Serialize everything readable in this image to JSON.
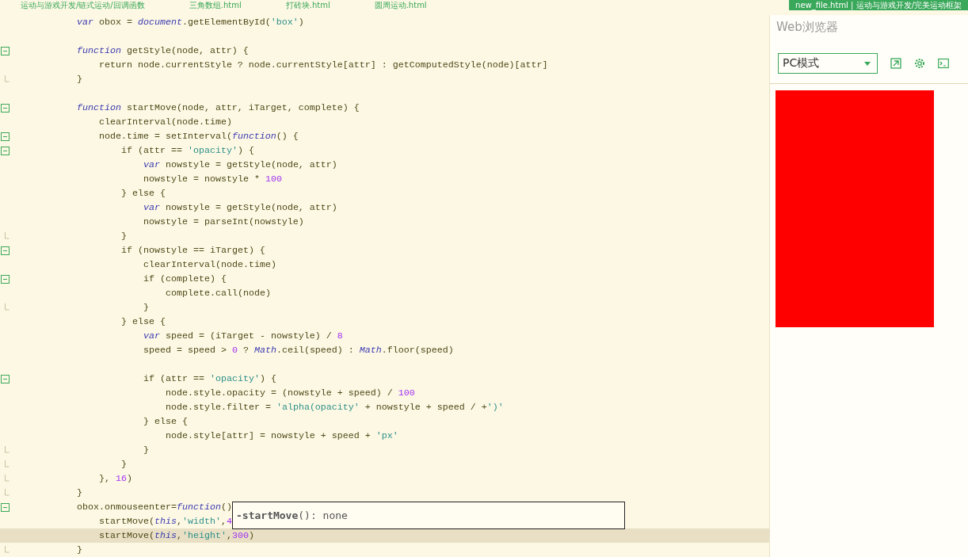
{
  "tabs": [
    {
      "label": "运动与游戏开发/链式运动/回调函数",
      "selected": false
    },
    {
      "label": "三角数组.html",
      "selected": false
    },
    {
      "label": "打砖块.html",
      "selected": false
    },
    {
      "label": "圆周运动.html",
      "selected": false
    },
    {
      "label": "new_file.html | 运动与游戏开发/完美运动框架",
      "selected": true
    }
  ],
  "editor": {
    "lines": [
      {
        "kind": "code",
        "active": false,
        "foldable": false,
        "tokens": [
          {
            "kind": "keyword",
            "text": "var"
          },
          {
            "kind": "plain",
            "text": " obox = "
          },
          {
            "kind": "keyword",
            "text": "document"
          },
          {
            "kind": "plain",
            "text": ".getElementById("
          },
          {
            "kind": "string",
            "text": "'box'"
          },
          {
            "kind": "plain",
            "text": ")"
          }
        ]
      },
      {
        "kind": "blank"
      },
      {
        "kind": "code",
        "active": false,
        "foldable": true,
        "tokens": [
          {
            "kind": "keyword",
            "text": "function"
          },
          {
            "kind": "plain",
            "text": " getStyle(node, attr) {"
          }
        ],
        "children": [
          {
            "kind": "code",
            "active": false,
            "foldable": false,
            "tokens": [
              {
                "kind": "plain",
                "text": "return node.currentStyle ? node.currentStyle[attr] : getComputedStyle(node)[attr]"
              }
            ]
          }
        ],
        "close": [
          {
            "kind": "plain",
            "text": "}"
          }
        ]
      },
      {
        "kind": "blank"
      },
      {
        "kind": "code",
        "active": false,
        "foldable": true,
        "tokens": [
          {
            "kind": "keyword",
            "text": "function"
          },
          {
            "kind": "plain",
            "text": " startMove(node, attr, iTarget, complete) {"
          }
        ],
        "children": [
          {
            "kind": "code",
            "active": false,
            "foldable": false,
            "tokens": [
              {
                "kind": "plain",
                "text": "clearInterval(node.time)"
              }
            ]
          },
          {
            "kind": "code",
            "active": false,
            "foldable": true,
            "tokens": [
              {
                "kind": "plain",
                "text": "node.time = setInterval("
              },
              {
                "kind": "keyword",
                "text": "function"
              },
              {
                "kind": "plain",
                "text": "() {"
              }
            ],
            "children": [
              {
                "kind": "code",
                "active": false,
                "foldable": true,
                "tokens": [
                  {
                    "kind": "plain",
                    "text": "if (attr == "
                  },
                  {
                    "kind": "string",
                    "text": "'opacity'"
                  },
                  {
                    "kind": "plain",
                    "text": ") {"
                  }
                ],
                "children": [
                  {
                    "kind": "code",
                    "active": false,
                    "foldable": false,
                    "tokens": [
                      {
                        "kind": "keyword",
                        "text": "var"
                      },
                      {
                        "kind": "plain",
                        "text": " nowstyle = getStyle(node, attr)"
                      }
                    ]
                  },
                  {
                    "kind": "code",
                    "active": false,
                    "foldable": false,
                    "tokens": [
                      {
                        "kind": "plain",
                        "text": "nowstyle = nowstyle * "
                      },
                      {
                        "kind": "number",
                        "text": "100"
                      }
                    ]
                  }
                ]
              },
              {
                "kind": "code",
                "active": false,
                "foldable": false,
                "tokens": [
                  {
                    "kind": "plain",
                    "text": "} else {"
                  }
                ],
                "children": [
                  {
                    "kind": "code",
                    "active": false,
                    "foldable": false,
                    "tokens": [
                      {
                        "kind": "keyword",
                        "text": "var"
                      },
                      {
                        "kind": "plain",
                        "text": " nowstyle = getStyle(node, attr)"
                      }
                    ]
                  },
                  {
                    "kind": "code",
                    "active": false,
                    "foldable": false,
                    "tokens": [
                      {
                        "kind": "plain",
                        "text": "nowstyle = parseInt(nowstyle)"
                      }
                    ]
                  }
                ],
                "close": [
                  {
                    "kind": "plain",
                    "text": "}"
                  }
                ]
              },
              {
                "kind": "code",
                "active": false,
                "foldable": true,
                "tokens": [
                  {
                    "kind": "plain",
                    "text": "if (nowstyle == iTarget) {"
                  }
                ],
                "children": [
                  {
                    "kind": "code",
                    "active": false,
                    "foldable": false,
                    "tokens": [
                      {
                        "kind": "plain",
                        "text": "clearInterval(node.time)"
                      }
                    ]
                  },
                  {
                    "kind": "code",
                    "active": false,
                    "foldable": true,
                    "tokens": [
                      {
                        "kind": "plain",
                        "text": "if (complete) {"
                      }
                    ],
                    "children": [
                      {
                        "kind": "code",
                        "active": false,
                        "foldable": false,
                        "tokens": [
                          {
                            "kind": "plain",
                            "text": "complete.call(node)"
                          }
                        ]
                      }
                    ],
                    "close": [
                      {
                        "kind": "plain",
                        "text": "}"
                      }
                    ]
                  }
                ]
              },
              {
                "kind": "code",
                "active": false,
                "foldable": false,
                "tokens": [
                  {
                    "kind": "plain",
                    "text": "} else {"
                  }
                ],
                "children": [
                  {
                    "kind": "code",
                    "active": false,
                    "foldable": false,
                    "tokens": [
                      {
                        "kind": "keyword",
                        "text": "var"
                      },
                      {
                        "kind": "plain",
                        "text": " speed = (iTarget - nowstyle) / "
                      },
                      {
                        "kind": "number",
                        "text": "8"
                      }
                    ]
                  },
                  {
                    "kind": "code",
                    "active": false,
                    "foldable": false,
                    "tokens": [
                      {
                        "kind": "plain",
                        "text": "speed = speed > "
                      },
                      {
                        "kind": "number",
                        "text": "0"
                      },
                      {
                        "kind": "plain",
                        "text": " ? "
                      },
                      {
                        "kind": "keyword",
                        "text": "Math"
                      },
                      {
                        "kind": "plain",
                        "text": ".ceil(speed) : "
                      },
                      {
                        "kind": "keyword",
                        "text": "Math"
                      },
                      {
                        "kind": "plain",
                        "text": ".floor(speed)"
                      }
                    ]
                  },
                  {
                    "kind": "blank"
                  },
                  {
                    "kind": "code",
                    "active": false,
                    "foldable": true,
                    "tokens": [
                      {
                        "kind": "plain",
                        "text": "if (attr == "
                      },
                      {
                        "kind": "string",
                        "text": "'opacity'"
                      },
                      {
                        "kind": "plain",
                        "text": ") {"
                      }
                    ],
                    "children": [
                      {
                        "kind": "code",
                        "active": false,
                        "foldable": false,
                        "tokens": [
                          {
                            "kind": "plain",
                            "text": "node.style.opacity = (nowstyle + speed) / "
                          },
                          {
                            "kind": "number",
                            "text": "100"
                          }
                        ]
                      },
                      {
                        "kind": "code",
                        "active": false,
                        "foldable": false,
                        "tokens": [
                          {
                            "kind": "plain",
                            "text": "node.style.filter = "
                          },
                          {
                            "kind": "string",
                            "text": "'alpha(opacity'"
                          },
                          {
                            "kind": "plain",
                            "text": " + nowstyle + speed / +"
                          },
                          {
                            "kind": "string",
                            "text": "')'"
                          }
                        ]
                      }
                    ]
                  },
                  {
                    "kind": "code",
                    "active": false,
                    "foldable": false,
                    "tokens": [
                      {
                        "kind": "plain",
                        "text": "} else {"
                      }
                    ],
                    "children": [
                      {
                        "kind": "code",
                        "active": false,
                        "foldable": false,
                        "tokens": [
                          {
                            "kind": "plain",
                            "text": "node.style[attr] = nowstyle + speed + "
                          },
                          {
                            "kind": "string",
                            "text": "'px'"
                          }
                        ]
                      }
                    ],
                    "close": [
                      {
                        "kind": "plain",
                        "text": "}"
                      }
                    ]
                  }
                ],
                "close": [
                  {
                    "kind": "plain",
                    "text": "}"
                  }
                ]
              }
            ],
            "close": [
              {
                "kind": "plain",
                "text": "}, "
              },
              {
                "kind": "number",
                "text": "16"
              },
              {
                "kind": "plain",
                "text": ")"
              }
            ]
          }
        ],
        "close": [
          {
            "kind": "plain",
            "text": "}"
          }
        ]
      },
      {
        "kind": "code",
        "active": false,
        "foldable": true,
        "tokens": [
          {
            "kind": "plain",
            "text": "obox.onmouseenter="
          },
          {
            "kind": "keyword",
            "text": "function"
          },
          {
            "kind": "plain",
            "text": "()"
          }
        ],
        "children": [
          {
            "kind": "code",
            "active": false,
            "foldable": false,
            "tokens": [
              {
                "kind": "plain",
                "text": "startMove("
              },
              {
                "kind": "keyword",
                "text": "this"
              },
              {
                "kind": "plain",
                "text": ","
              },
              {
                "kind": "string",
                "text": "'width'"
              },
              {
                "kind": "plain",
                "text": ","
              },
              {
                "kind": "number",
                "text": "4"
              }
            ]
          },
          {
            "kind": "code",
            "active": true,
            "foldable": false,
            "tokens": [
              {
                "kind": "plain",
                "text": "startMove("
              },
              {
                "kind": "keyword",
                "text": "this"
              },
              {
                "kind": "plain",
                "text": ","
              },
              {
                "kind": "string",
                "text": "'height'"
              },
              {
                "kind": "plain",
                "text": ","
              },
              {
                "kind": "number",
                "text": "300"
              },
              {
                "kind": "plain",
                "text": ")"
              }
            ]
          }
        ],
        "close": [
          {
            "kind": "plain",
            "text": "}"
          }
        ]
      }
    ],
    "autocomplete": {
      "text": "**-startMove**(): none"
    }
  },
  "preview": {
    "title": "Web浏览器",
    "mode": {
      "value": "PC模式"
    }
  }
}
